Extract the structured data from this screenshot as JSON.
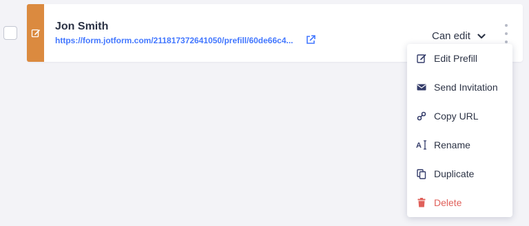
{
  "submission": {
    "name": "Jon Smith",
    "url": "https://form.jotform.com/211817372641050/prefill/60de66c4...",
    "permission": "Can edit"
  },
  "menu": {
    "items": [
      {
        "label": "Edit Prefill",
        "icon": "edit-icon"
      },
      {
        "label": "Send Invitation",
        "icon": "envelope-icon"
      },
      {
        "label": "Copy URL",
        "icon": "link-icon"
      },
      {
        "label": "Rename",
        "icon": "rename-icon"
      },
      {
        "label": "Duplicate",
        "icon": "duplicate-icon"
      },
      {
        "label": "Delete",
        "icon": "trash-icon"
      }
    ]
  },
  "colors": {
    "stripe": "#db8a3f",
    "link": "#4277ff",
    "text": "#2c3345",
    "danger": "#e0605a"
  }
}
